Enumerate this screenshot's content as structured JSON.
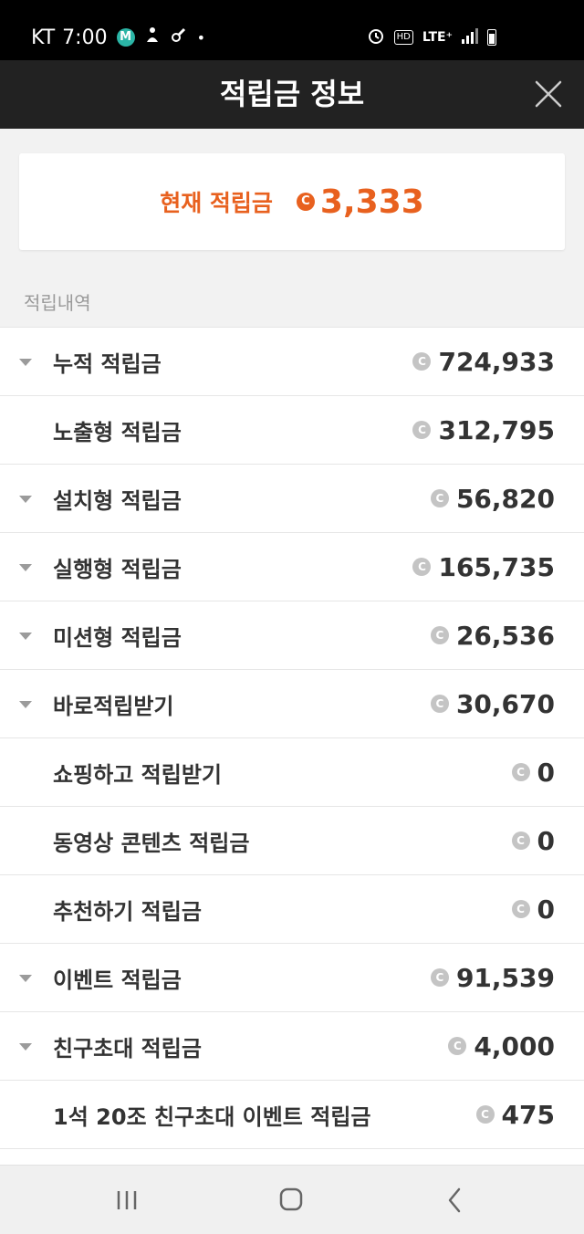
{
  "status_bar": {
    "carrier": "KT",
    "time": "7:00",
    "m_badge": "M",
    "dot": "•",
    "hd": "HD",
    "lte": "LTE⁺"
  },
  "header": {
    "title": "적립금 정보"
  },
  "current": {
    "label": "현재 적립금",
    "coin": "C",
    "value": "3,333"
  },
  "history": {
    "section_label": "적립내역",
    "coin": "C",
    "rows": [
      {
        "label": "누적 적립금",
        "value": "724,933",
        "expandable": true
      },
      {
        "label": "노출형 적립금",
        "value": "312,795",
        "expandable": false
      },
      {
        "label": "설치형 적립금",
        "value": "56,820",
        "expandable": true
      },
      {
        "label": "실행형 적립금",
        "value": "165,735",
        "expandable": true
      },
      {
        "label": "미션형 적립금",
        "value": "26,536",
        "expandable": true
      },
      {
        "label": "바로적립받기",
        "value": "30,670",
        "expandable": true
      },
      {
        "label": "쇼핑하고 적립받기",
        "value": "0",
        "expandable": false
      },
      {
        "label": "동영상 콘텐츠 적립금",
        "value": "0",
        "expandable": false
      },
      {
        "label": "추천하기 적립금",
        "value": "0",
        "expandable": false
      },
      {
        "label": "이벤트 적립금",
        "value": "91,539",
        "expandable": true
      },
      {
        "label": "친구초대 적립금",
        "value": "4,000",
        "expandable": true
      },
      {
        "label": "1석 20조 친구초대 이벤트 적립금",
        "value": "475",
        "expandable": false
      }
    ]
  },
  "colors": {
    "accent": "#e8611f",
    "header_bg": "#222222",
    "status_bg": "#000000",
    "coin_gray": "#c4c4c4"
  },
  "icons": {
    "close": "close-icon",
    "caret": "caret-down-icon",
    "nav_recents": "recents-icon",
    "nav_home": "home-icon",
    "nav_back": "back-icon"
  }
}
